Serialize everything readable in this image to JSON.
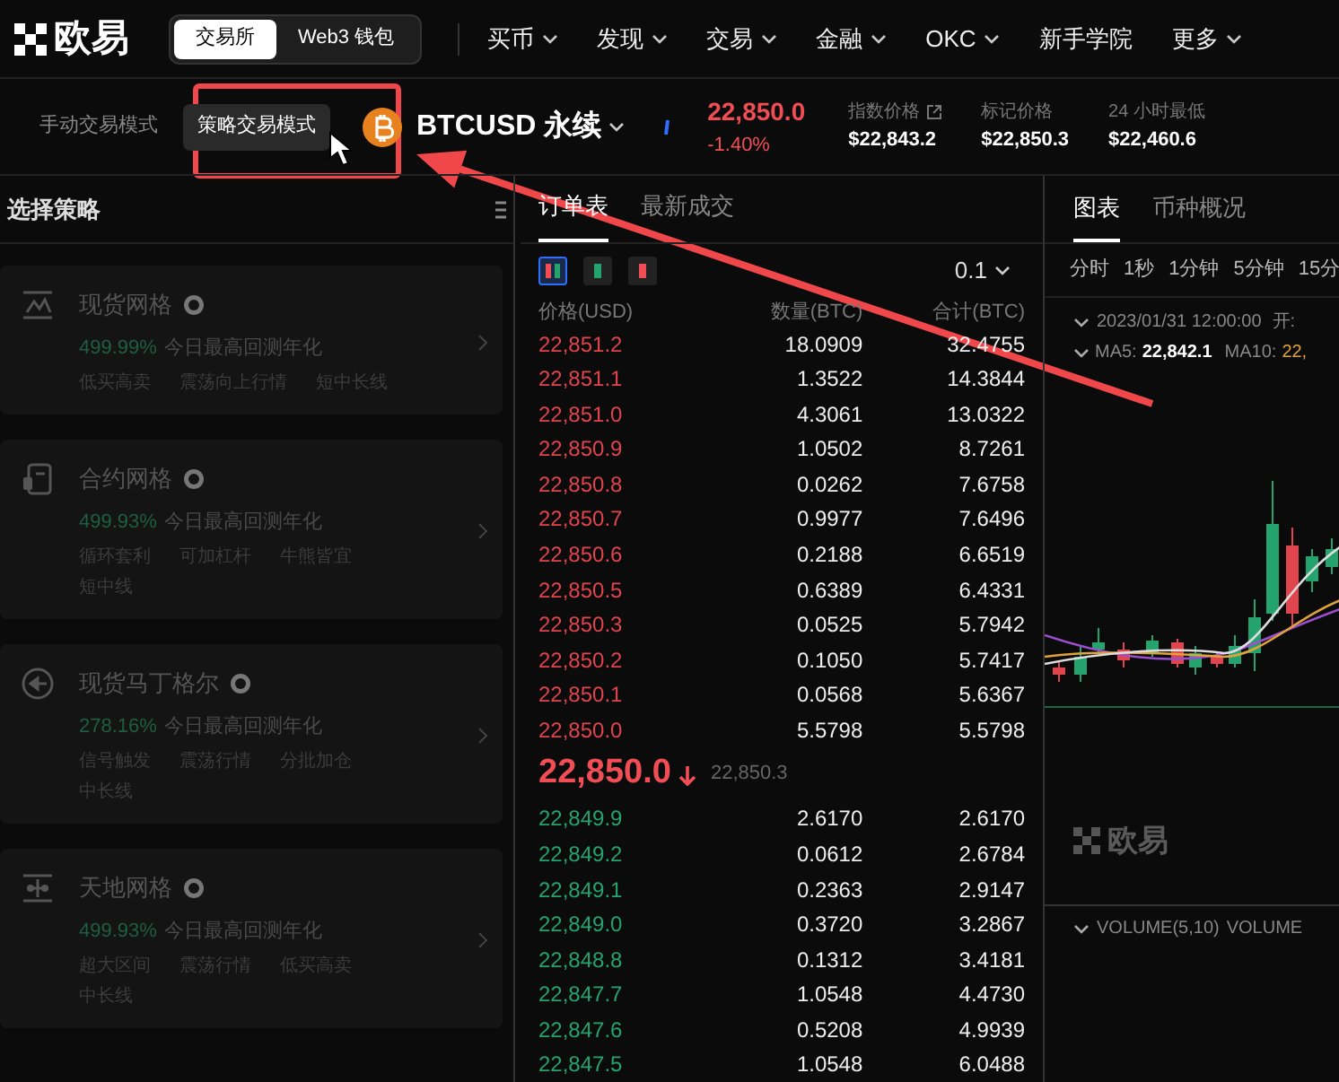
{
  "logo": {
    "text": "欧易"
  },
  "segment": [
    {
      "label": "交易所",
      "selected": true
    },
    {
      "label": "Web3 钱包",
      "selected": false
    }
  ],
  "nav": [
    {
      "label": "买币",
      "dropdown": true
    },
    {
      "label": "发现",
      "dropdown": true
    },
    {
      "label": "交易",
      "dropdown": true
    },
    {
      "label": "金融",
      "dropdown": true
    },
    {
      "label": "OKC",
      "dropdown": true
    },
    {
      "label": "新手学院",
      "dropdown": false
    },
    {
      "label": "更多",
      "dropdown": true
    }
  ],
  "modes": [
    {
      "label": "手动交易模式",
      "selected": false
    },
    {
      "label": "策略交易模式",
      "selected": true
    }
  ],
  "instrument": {
    "symbol": "BTCUSD 永续",
    "price": "22,850.0",
    "change": "-1.40%"
  },
  "stats": [
    {
      "label": "指数价格",
      "value": "$22,843.2",
      "link": true
    },
    {
      "label": "标记价格",
      "value": "$22,850.3",
      "link": false
    },
    {
      "label": "24 小时最低",
      "value": "$22,460.6",
      "link": false
    }
  ],
  "strategy_panel": {
    "title": "选择策略",
    "cards": [
      {
        "kind": "grid",
        "name": "现货网格",
        "rate": "499.99%",
        "rate_label": "今日最高回测年化",
        "tags": [
          "低买高卖",
          "震荡向上行情",
          "短中长线"
        ]
      },
      {
        "kind": "contract",
        "name": "合约网格",
        "rate": "499.93%",
        "rate_label": "今日最高回测年化",
        "tags": [
          "循环套利",
          "可加杠杆",
          "牛熊皆宜",
          "短中线"
        ]
      },
      {
        "kind": "martingale",
        "name": "现货马丁格尔",
        "rate": "278.16%",
        "rate_label": "今日最高回测年化",
        "tags": [
          "信号触发",
          "震荡行情",
          "分批加仓",
          "中长线"
        ]
      },
      {
        "kind": "infinity",
        "name": "天地网格",
        "rate": "499.93%",
        "rate_label": "今日最高回测年化",
        "tags": [
          "超大区间",
          "震荡行情",
          "低买高卖",
          "中长线"
        ]
      }
    ]
  },
  "order_book": {
    "tabs": [
      {
        "label": "订单表",
        "selected": true
      },
      {
        "label": "最新成交",
        "selected": false
      }
    ],
    "views": [
      {
        "kind": "both",
        "selected": true
      },
      {
        "kind": "bids",
        "selected": false
      },
      {
        "kind": "asks",
        "selected": false
      }
    ],
    "precision": "0.1",
    "columns": [
      "价格(USD)",
      "数量(BTC)",
      "合计(BTC)"
    ],
    "asks": [
      {
        "price": "22,851.2",
        "size": "18.0909",
        "total": "32.4755"
      },
      {
        "price": "22,851.1",
        "size": "1.3522",
        "total": "14.3844"
      },
      {
        "price": "22,851.0",
        "size": "4.3061",
        "total": "13.0322"
      },
      {
        "price": "22,850.9",
        "size": "1.0502",
        "total": "8.7261"
      },
      {
        "price": "22,850.8",
        "size": "0.0262",
        "total": "7.6758"
      },
      {
        "price": "22,850.7",
        "size": "0.9977",
        "total": "7.6496"
      },
      {
        "price": "22,850.6",
        "size": "0.2188",
        "total": "6.6519"
      },
      {
        "price": "22,850.5",
        "size": "0.6389",
        "total": "6.4331"
      },
      {
        "price": "22,850.3",
        "size": "0.0525",
        "total": "5.7942"
      },
      {
        "price": "22,850.2",
        "size": "0.1050",
        "total": "5.7417"
      },
      {
        "price": "22,850.1",
        "size": "0.0568",
        "total": "5.6367"
      },
      {
        "price": "22,850.0",
        "size": "5.5798",
        "total": "5.5798"
      }
    ],
    "last_price": "22,850.0",
    "mark_price": "22,850.3",
    "bids": [
      {
        "price": "22,849.9",
        "size": "2.6170",
        "total": "2.6170"
      },
      {
        "price": "22,849.2",
        "size": "0.0612",
        "total": "2.6784"
      },
      {
        "price": "22,849.1",
        "size": "0.2363",
        "total": "2.9147"
      },
      {
        "price": "22,849.0",
        "size": "0.3720",
        "total": "3.2867"
      },
      {
        "price": "22,848.8",
        "size": "0.1312",
        "total": "3.4181"
      },
      {
        "price": "22,847.7",
        "size": "1.0548",
        "total": "4.4730"
      },
      {
        "price": "22,847.6",
        "size": "0.5208",
        "total": "4.9939"
      },
      {
        "price": "22,847.5",
        "size": "1.0548",
        "total": "6.0488"
      }
    ]
  },
  "chart_panel": {
    "tabs": [
      {
        "label": "图表",
        "selected": true
      },
      {
        "label": "币种概况",
        "selected": false
      }
    ],
    "intervals": [
      "分时",
      "1秒",
      "1分钟",
      "5分钟",
      "15分"
    ],
    "date": "2023/01/31 12:00:00",
    "open_label": "开:",
    "ma5_label": "MA5:",
    "ma5": "22,842.1",
    "ma10_label": "MA10:",
    "ma10": "22,",
    "watermark": "欧易",
    "volume_labels": [
      "VOLUME(5,10)",
      "VOLUME"
    ]
  }
}
